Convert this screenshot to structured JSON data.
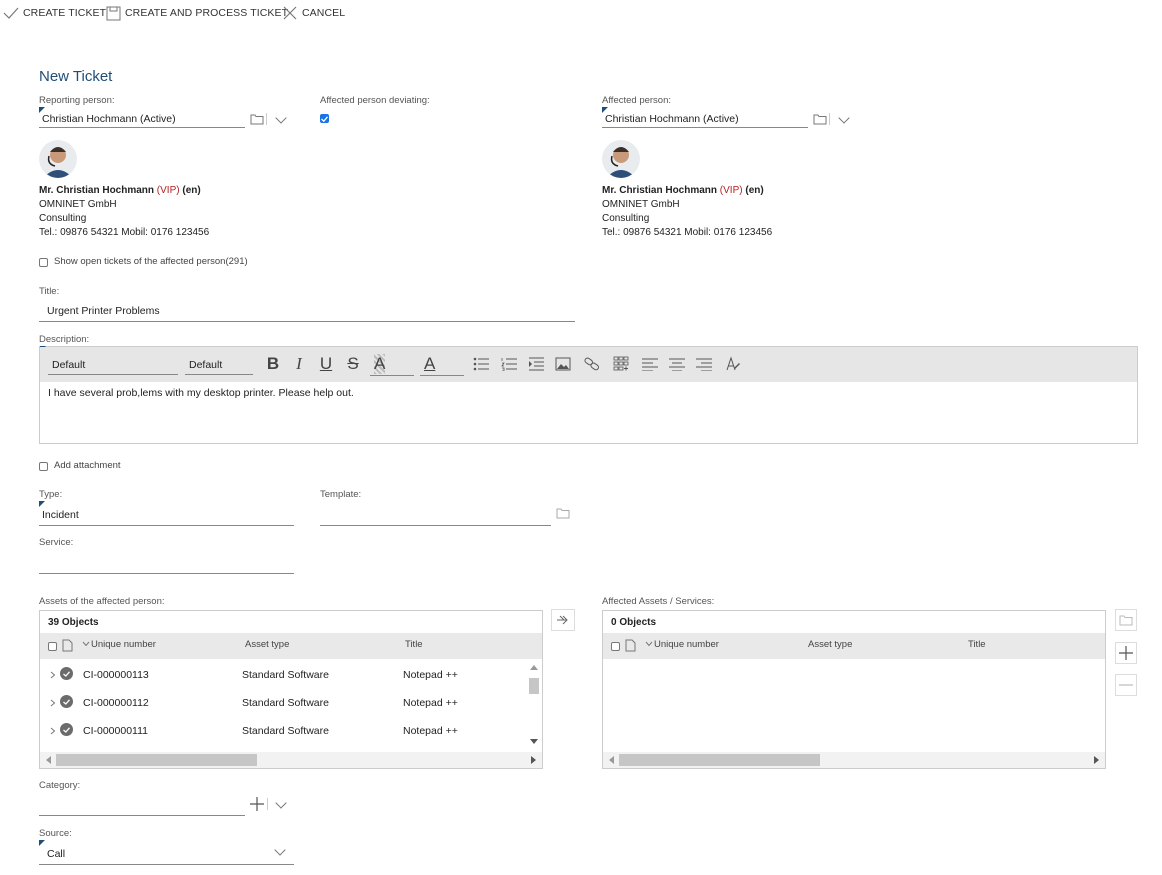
{
  "toolbar": {
    "create_ticket": "CREATE TICKET",
    "create_and_process": "CREATE AND PROCESS TICKET",
    "cancel": "CANCEL"
  },
  "page": {
    "heading": "New Ticket"
  },
  "reporting": {
    "label": "Reporting person:",
    "value": "Christian Hochmann (Active)"
  },
  "deviating": {
    "label": "Affected person deviating:",
    "checked": true
  },
  "affected": {
    "label": "Affected person:",
    "value": "Christian Hochmann (Active)"
  },
  "person_card": {
    "name": "Mr. Christian Hochmann",
    "vip": "(VIP)",
    "lang": "(en)",
    "company": "OMNINET GmbH",
    "department": "Consulting",
    "phones": "Tel.: 09876 54321 Mobil: 0176 123456"
  },
  "open_tickets": {
    "label": "Show open tickets of the affected person(291)",
    "checked": false
  },
  "title_field": {
    "label": "Title:",
    "value": "Urgent Printer Problems"
  },
  "description": {
    "label": "Description:",
    "font_family": "Default",
    "font_size": "Default",
    "text": "I have several prob,lems with my desktop printer. Please help out."
  },
  "attachment": {
    "label": "Add attachment",
    "checked": false
  },
  "type_field": {
    "label": "Type:",
    "value": "Incident"
  },
  "template_field": {
    "label": "Template:",
    "value": ""
  },
  "service_field": {
    "label": "Service:",
    "value": ""
  },
  "assets_grid": {
    "label": "Assets of the affected person:",
    "count": "39 Objects",
    "columns": [
      "Unique number",
      "Asset type",
      "Title"
    ],
    "rows": [
      {
        "number": "CI-000000113",
        "type": "Standard Software",
        "title": "Notepad ++"
      },
      {
        "number": "CI-000000112",
        "type": "Standard Software",
        "title": "Notepad ++"
      },
      {
        "number": "CI-000000111",
        "type": "Standard Software",
        "title": "Notepad ++"
      }
    ]
  },
  "affected_grid": {
    "label": "Affected Assets / Services:",
    "count": "0 Objects",
    "columns": [
      "Unique number",
      "Asset type",
      "Title"
    ]
  },
  "category_field": {
    "label": "Category:",
    "value": ""
  },
  "source_field": {
    "label": "Source:",
    "value": "Call"
  },
  "colors": {
    "accent": "#1f4e79",
    "vip": "#b22222",
    "checkbox": "#1a73e8"
  }
}
